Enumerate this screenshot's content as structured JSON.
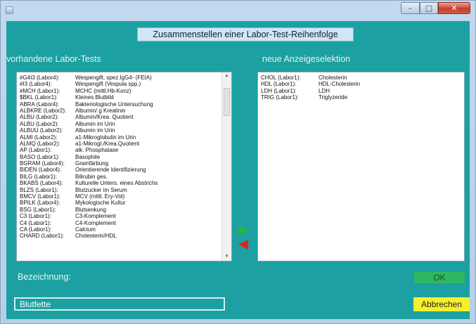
{
  "window": {
    "min_glyph": "–",
    "max_glyph": "□",
    "close_glyph": "✕"
  },
  "dialog": {
    "title": "Zusammenstellen einer Labor-Test-Reihenfolge"
  },
  "available": {
    "label": "vorhandene Labor-Tests",
    "items": [
      {
        "code": "#G4I3 (Labor4):",
        "desc": "Wespengift, spez.IgG4- (FEIA)"
      },
      {
        "code": "#I3 (Labor4):",
        "desc": "Wespengift (Vespula spp.)"
      },
      {
        "code": "#MCH (Labor1):",
        "desc": "MCHC (mittl.Hb-Konz)"
      },
      {
        "code": "$BKL (Labor1):",
        "desc": "Kleines Blutbild"
      },
      {
        "code": "ABRA (Labor4):",
        "desc": "Bakteriologische Untersuchung"
      },
      {
        "code": "ALBKRE (Labor2):",
        "desc": "Albumin/ g Kreatinin"
      },
      {
        "code": "ALBU (Labor2):",
        "desc": "Albumin/Krea. Quotient"
      },
      {
        "code": "ALBU (Labor2):",
        "desc": "Albumin im Urin"
      },
      {
        "code": "ALBUU (Labor2):",
        "desc": "Albumin im Urin"
      },
      {
        "code": "ALMI (Labor2):",
        "desc": "a1-Mikroglobulin im Urin"
      },
      {
        "code": "ALMQ (Labor2):",
        "desc": "a1-Mikrogl./Krea.Quotient"
      },
      {
        "code": "AP (Labor1):",
        "desc": "alk. Phosphatase"
      },
      {
        "code": "BASO (Labor1):",
        "desc": "Basophile"
      },
      {
        "code": "BGRAM (Labor4):",
        "desc": "Gramfärbung"
      },
      {
        "code": "BIDEN (Labor4):",
        "desc": "Orientierende Identifizierung"
      },
      {
        "code": "BILG (Labor1):",
        "desc": "Bilirubin ges."
      },
      {
        "code": "BKABS (Labor4):",
        "desc": "Kulturelle Unters. eines Abstrichs"
      },
      {
        "code": "BLZS (Labor1):",
        "desc": "Blutzucker im Serum"
      },
      {
        "code": "BMCV (Labor1):",
        "desc": "MCV (mittl. Ery-Vol)"
      },
      {
        "code": "BPILK (Labor4):",
        "desc": "Mykologische Kultur"
      },
      {
        "code": "BSG (Labor1):",
        "desc": "Blutsenkung"
      },
      {
        "code": "C3 (Labor1):",
        "desc": "C3-Komplement"
      },
      {
        "code": "C4 (Labor1):",
        "desc": "C4-Komplement"
      },
      {
        "code": "CA (Labor1):",
        "desc": "Calcium"
      },
      {
        "code": "CHARD (Labor1):",
        "desc": "Cholesterin/HDL"
      }
    ]
  },
  "selected": {
    "label": "neue Anzeigeselektion",
    "items": [
      {
        "code": "CHOL (Labor1):",
        "desc": "Cholesterin"
      },
      {
        "code": "HDL (Labor1):",
        "desc": "HDL-Cholesterin"
      },
      {
        "code": "LDH (Labor1):",
        "desc": "LDH"
      },
      {
        "code": "TRIG (Labor1):",
        "desc": "Triglyzeride"
      }
    ]
  },
  "scroll": {
    "up_glyph": "▲",
    "down_glyph": "▼"
  },
  "bezeichnung": {
    "label": "Bezeichnung:",
    "value": "Blutfette"
  },
  "buttons": {
    "ok": "OK",
    "cancel": "Abbrechen"
  }
}
